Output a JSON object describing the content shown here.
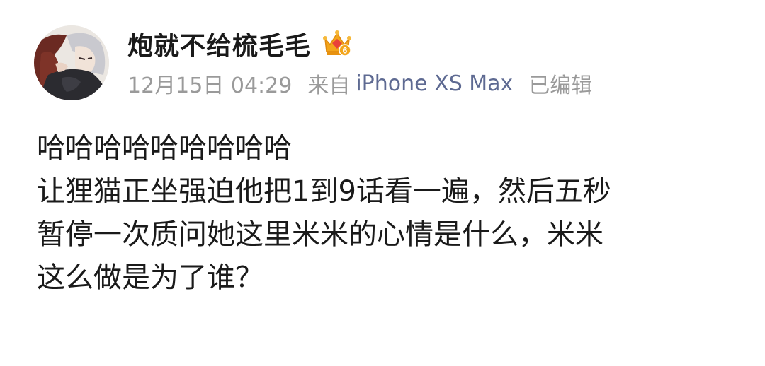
{
  "post": {
    "author": {
      "name": "炮就不给梳毛毛",
      "avatar_icon": "anime-character-avatar-icon",
      "badge_icon": "vip-crown-icon",
      "badge_level": "6",
      "badge_color": "#f3a51b"
    },
    "meta": {
      "timestamp": "12月15日 04:29",
      "source_prefix": "来自",
      "source_device": "iPhone XS Max",
      "edited_label": "已编辑",
      "source_color": "#5e6a92",
      "meta_color": "#9a9a9a"
    },
    "content_lines": [
      "哈哈哈哈哈哈哈哈哈",
      "让狸猫正坐强迫他把1到9话看一遍，然后五秒",
      "暂停一次质问她这里米米的心情是什么，米米",
      "这么做是为了谁？"
    ]
  }
}
